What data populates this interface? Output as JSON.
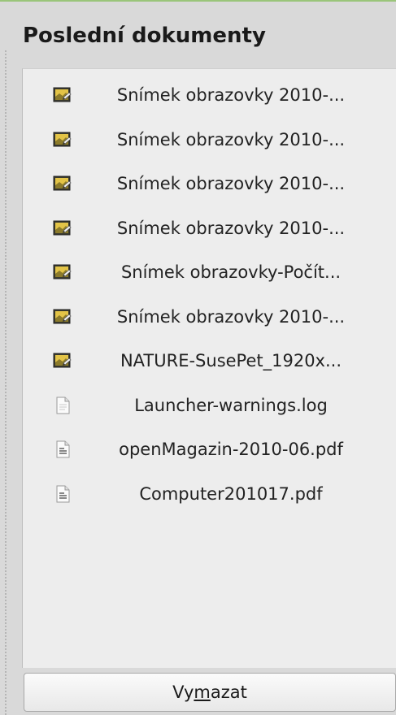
{
  "panel": {
    "title": "Poslední dokumenty"
  },
  "recent_documents": [
    {
      "label": "Snímek obrazovky 2010-...",
      "icon": "image-file-icon"
    },
    {
      "label": "Snímek obrazovky 2010-...",
      "icon": "image-file-icon"
    },
    {
      "label": "Snímek obrazovky 2010-...",
      "icon": "image-file-icon"
    },
    {
      "label": "Snímek obrazovky 2010-...",
      "icon": "image-file-icon"
    },
    {
      "label": "Snímek obrazovky-Počít...",
      "icon": "image-file-icon"
    },
    {
      "label": "Snímek obrazovky 2010-...",
      "icon": "image-file-icon"
    },
    {
      "label": "NATURE-SusePet_1920x...",
      "icon": "image-file-icon"
    },
    {
      "label": "Launcher-warnings.log",
      "icon": "text-file-icon"
    },
    {
      "label": "openMagazin-2010-06.pdf",
      "icon": "document-file-icon"
    },
    {
      "label": "Computer201017.pdf",
      "icon": "document-file-icon"
    }
  ],
  "clear_button": {
    "label_before": "Vy",
    "label_mnemonic": "m",
    "label_after": "azat"
  }
}
